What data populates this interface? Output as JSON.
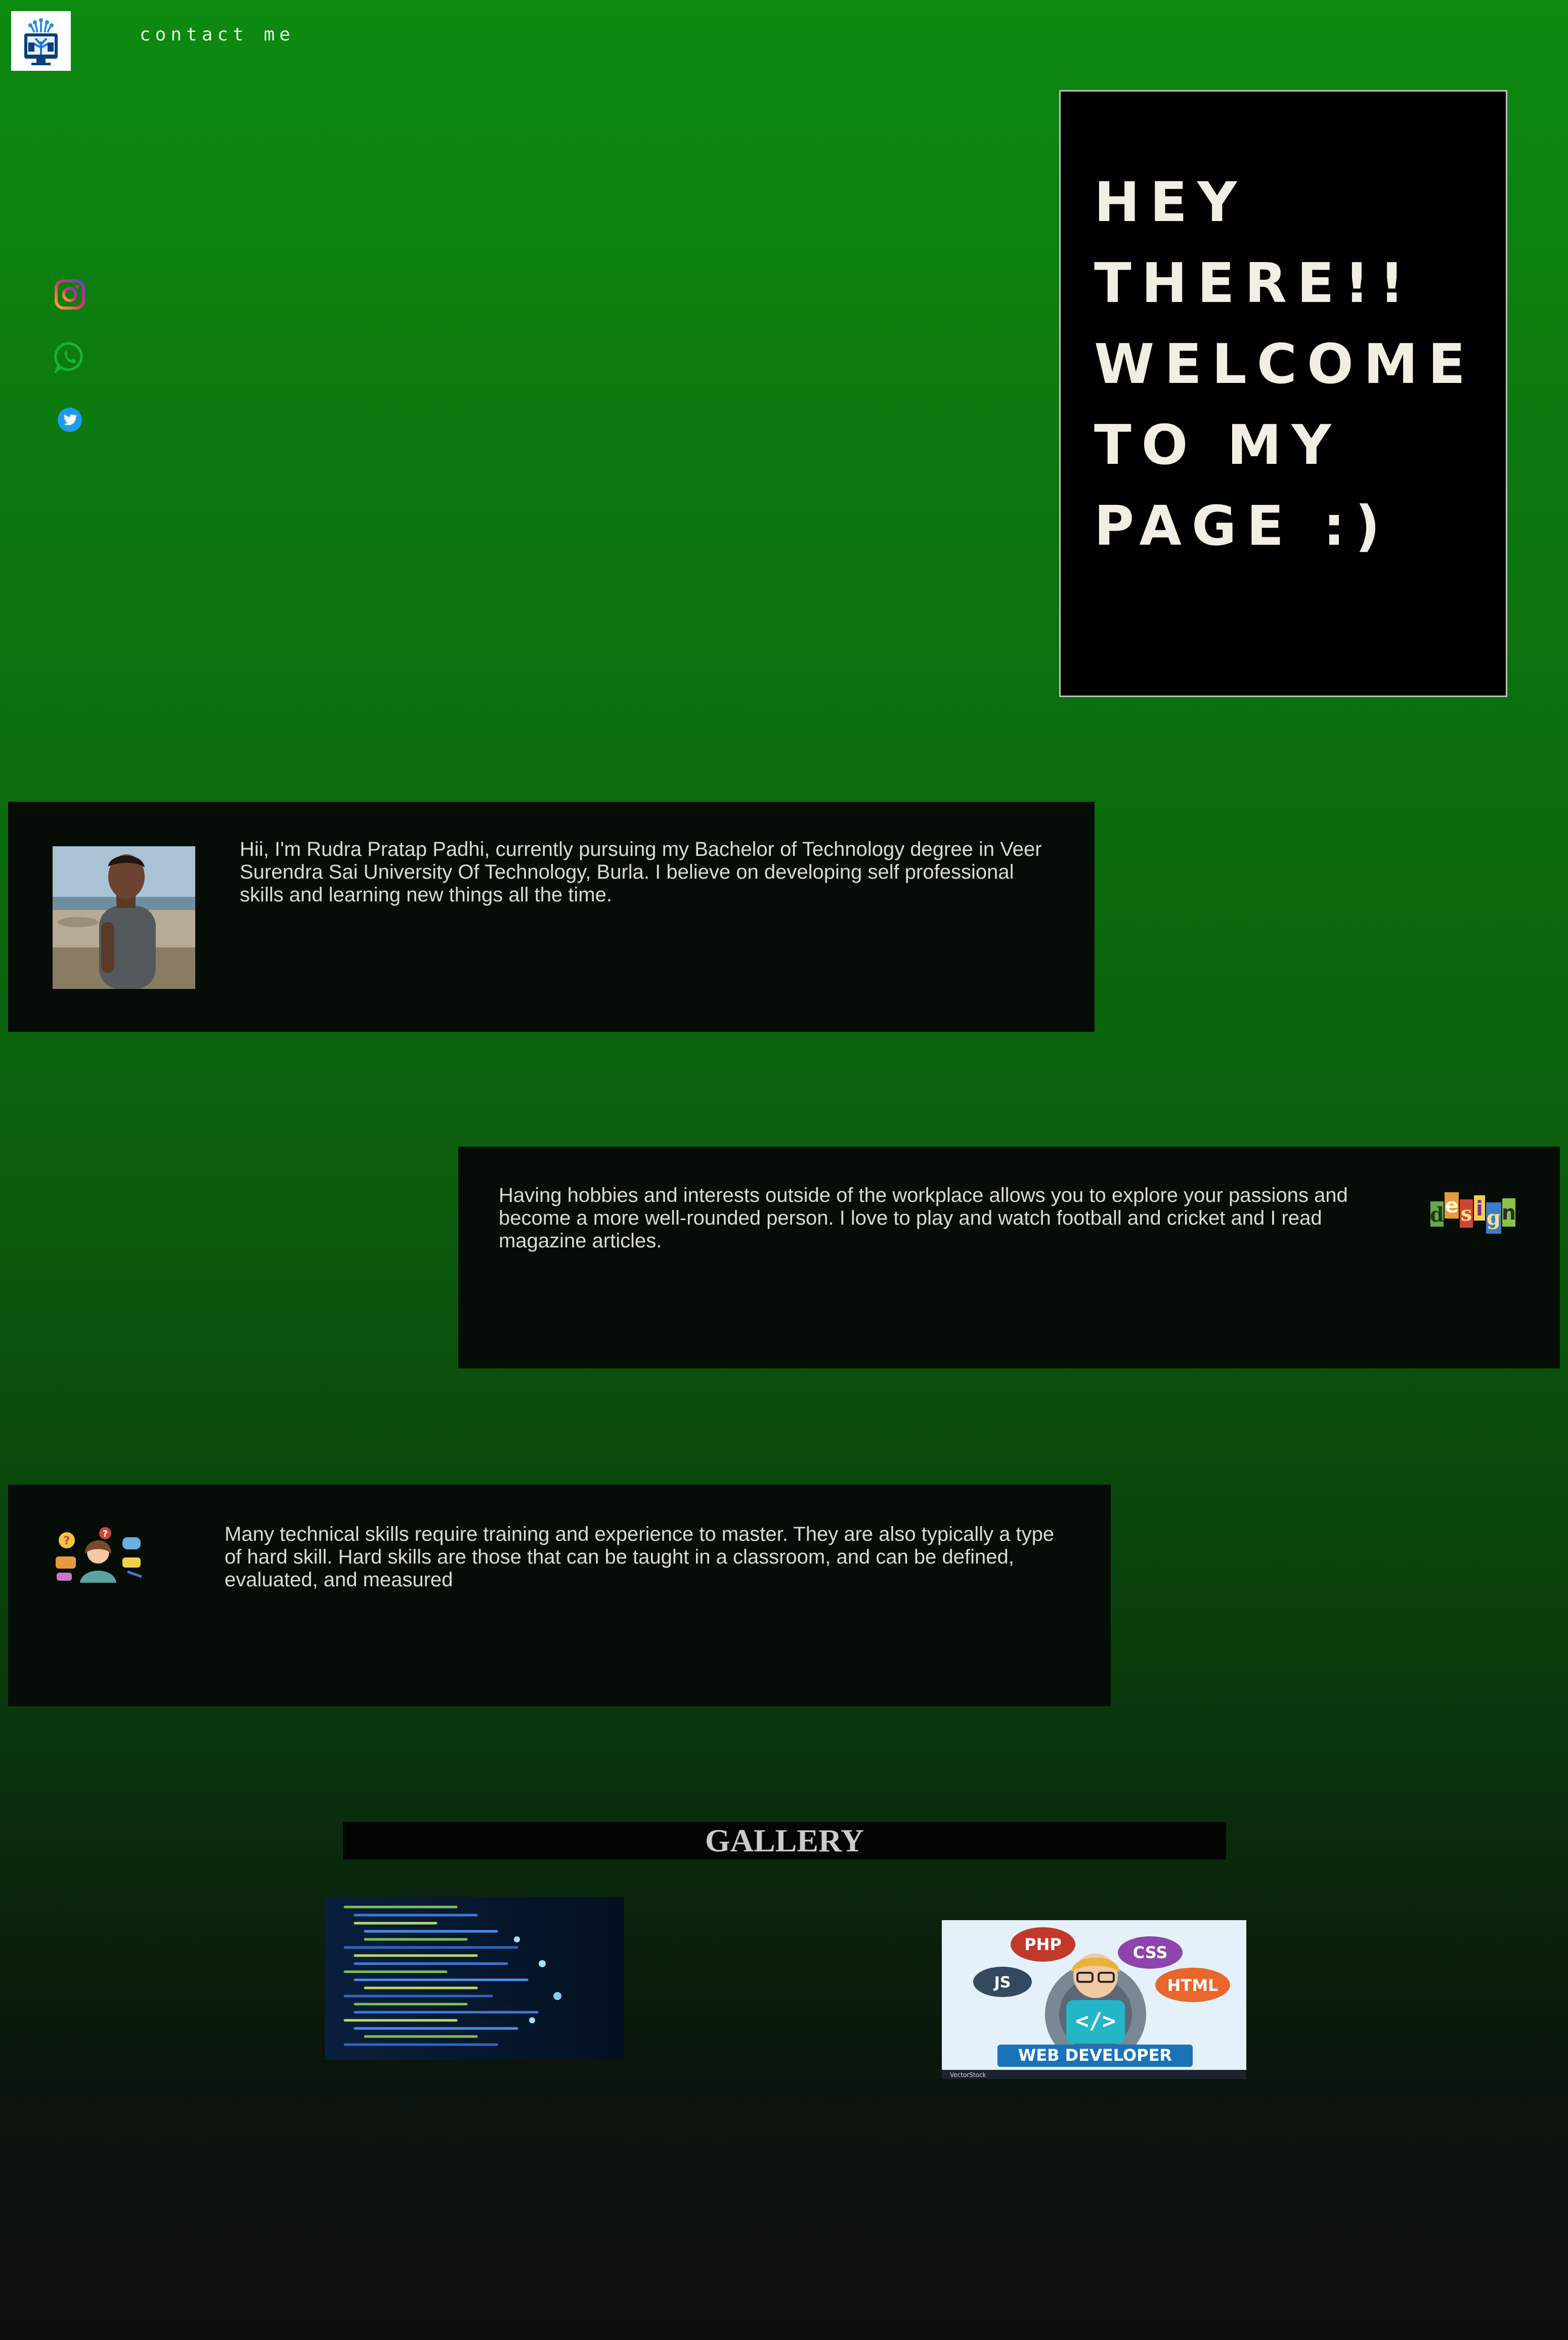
{
  "nav": {
    "contact_label": "contact me"
  },
  "social": {
    "instagram_icon": "instagram-icon",
    "whatsapp_icon": "whatsapp-icon",
    "twitter_icon": "twitter-icon"
  },
  "hero": {
    "title": "HEY THERE!! WELCOME TO MY PAGE :)"
  },
  "about": {
    "text": "Hii, I'm Rudra Pratap Padhi, currently pursuing my Bachelor of Technology degree in Veer Surendra Sai University Of Technology, Burla. I believe on developing self professional skills and learning new things all the time."
  },
  "hobbies": {
    "text": "Having hobbies and interests outside of the workplace allows you to explore your passions and become a more well-rounded person. I love to play and watch football and cricket and I read magazine articles.",
    "image_word": "design"
  },
  "skills": {
    "text": "Many technical skills require training and experience to master. They are also typically a type of hard skill. Hard skills are those that can be taught in a classroom, and can be defined, evaluated, and measured"
  },
  "gallery": {
    "title": "GALLERY",
    "web_dev": {
      "badges": [
        "PHP",
        "CSS",
        "JS",
        "HTML"
      ],
      "code_symbol": "</>",
      "banner": "WEB DEVELOPER",
      "watermark": "VectorStock"
    }
  },
  "colors": {
    "bg_top": "#0d8a10",
    "bg_bottom": "#0d0f0e",
    "card_bg": "#050d06",
    "hero_bg": "#000000",
    "hero_text": "#f1efe3"
  }
}
